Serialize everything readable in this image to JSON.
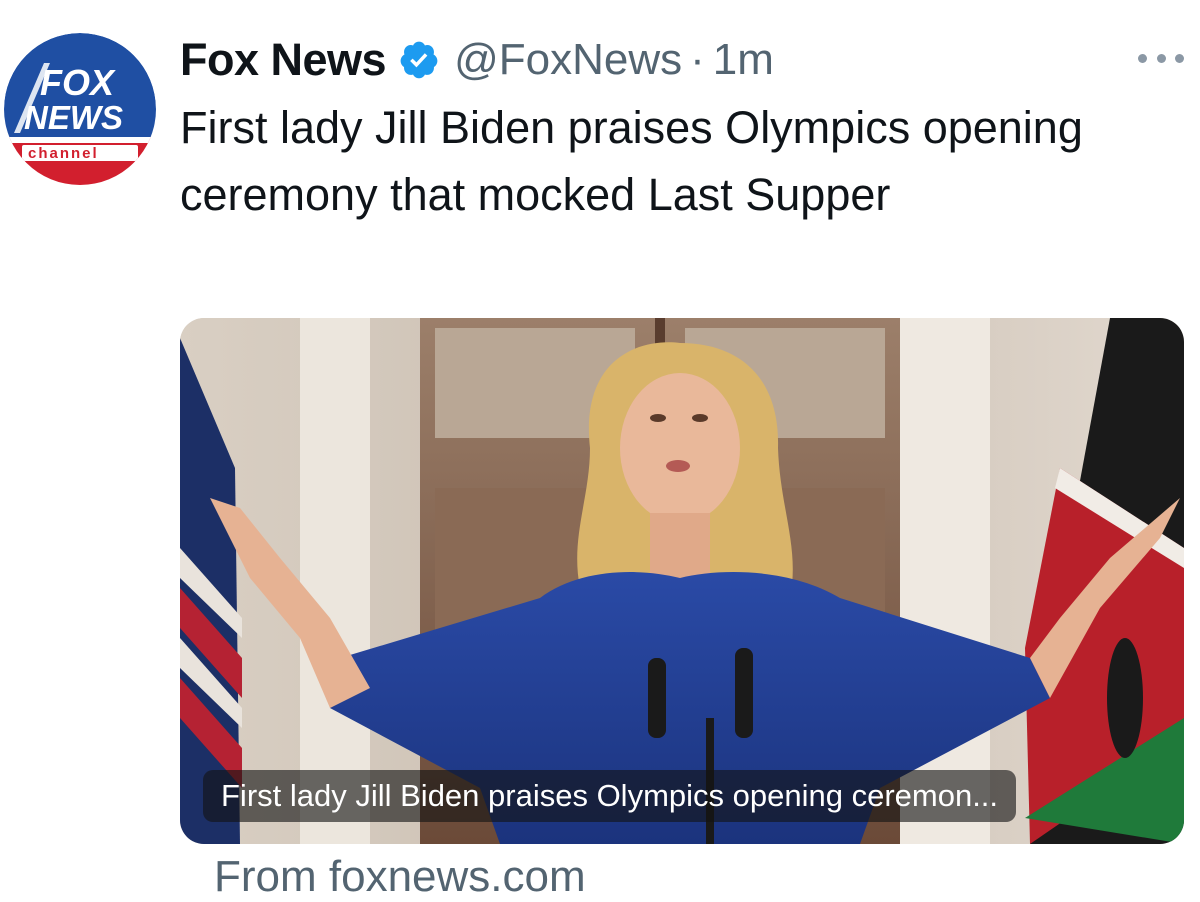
{
  "tweet": {
    "author_name": "Fox News",
    "verified": true,
    "handle": "@FoxNews",
    "separator": "·",
    "time": "1m",
    "text": "First lady Jill Biden praises Olympics opening ceremony that mocked Last Supper",
    "more_icon": "more-horizontal-icon"
  },
  "avatar": {
    "logo_line1": "FOX",
    "logo_line2": "NEWS",
    "logo_line3": "channel"
  },
  "link_card": {
    "caption": "First lady Jill Biden praises Olympics opening ceremon...",
    "source": "From foxnews.com"
  },
  "colors": {
    "verified_blue": "#1d9bf0",
    "secondary_text": "#536471",
    "fox_blue": "#1a3f91",
    "fox_red": "#c8102e"
  }
}
